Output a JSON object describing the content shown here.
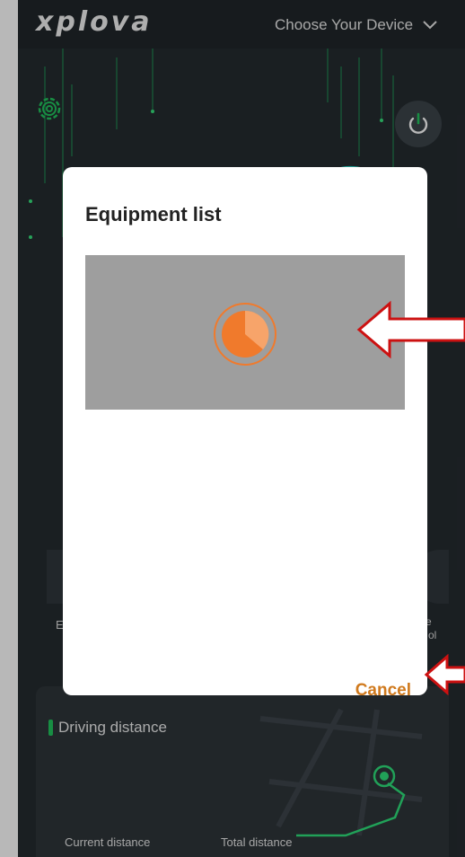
{
  "app": {
    "logo_text": "xplova",
    "device_selector_label": "Choose Your Device"
  },
  "background": {
    "side_label_left": "E",
    "side_label_right_line1": "e",
    "side_label_right_line2": "ol",
    "driving_distance_title": "Driving distance",
    "current_distance_label": "Current distance",
    "total_distance_label": "Total distance"
  },
  "dialog": {
    "title": "Equipment list",
    "cancel_label": "Cancel"
  },
  "colors": {
    "accent_green": "#22c55e",
    "spinner_orange": "#f07a2c",
    "cancel_orange": "#d07a1e",
    "callout_red": "#cc1111"
  },
  "icons": {
    "settings": "gear-icon",
    "power": "power-icon",
    "dropdown": "chevron-down-icon",
    "loading": "loading-spinner-icon",
    "callout": "arrow-left-icon"
  }
}
